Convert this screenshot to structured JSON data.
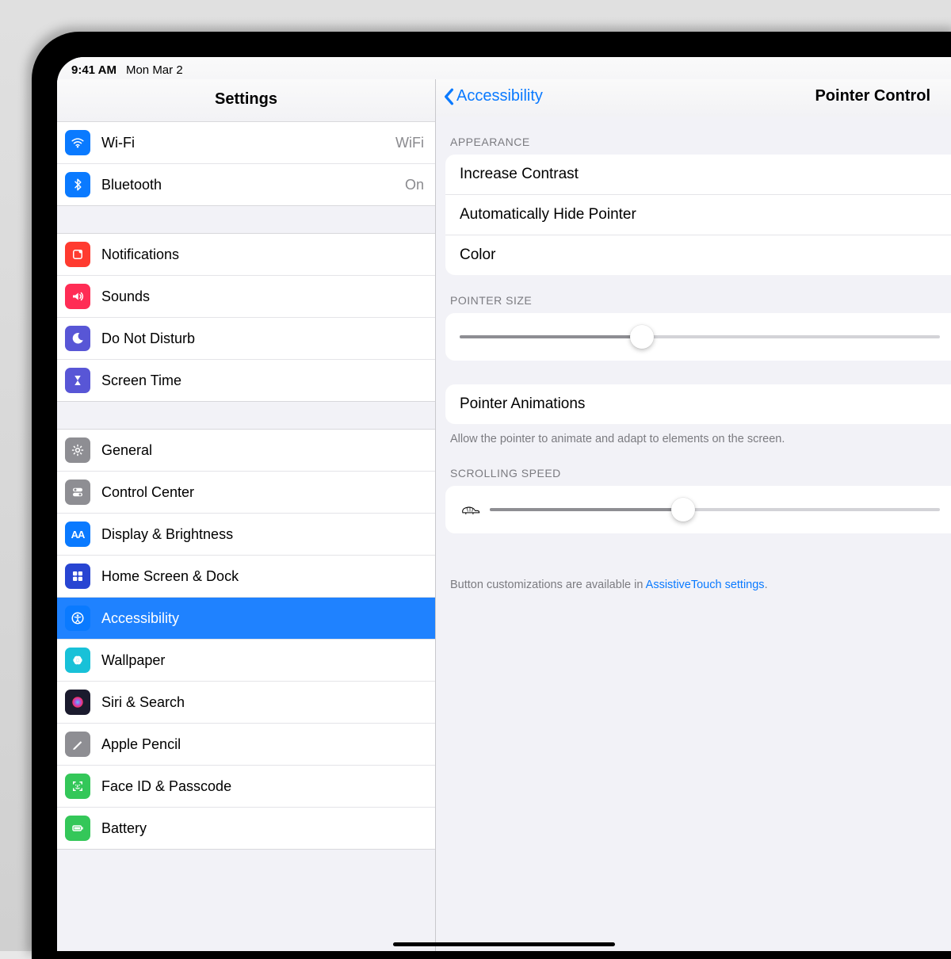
{
  "statusbar": {
    "time": "9:41 AM",
    "date": "Mon Mar 2"
  },
  "sidebar": {
    "title": "Settings",
    "groups": [
      [
        {
          "id": "wifi",
          "label": "Wi-Fi",
          "value": "WiFi",
          "icon": "wifi",
          "bg": "#0a7aff"
        },
        {
          "id": "bluetooth",
          "label": "Bluetooth",
          "value": "On",
          "icon": "bluetooth",
          "bg": "#0a7aff"
        }
      ],
      [
        {
          "id": "notifications",
          "label": "Notifications",
          "icon": "bell-badge",
          "bg": "#ff3b30"
        },
        {
          "id": "sounds",
          "label": "Sounds",
          "icon": "speaker",
          "bg": "#ff2d55"
        },
        {
          "id": "dnd",
          "label": "Do Not Disturb",
          "icon": "moon",
          "bg": "#5856d6"
        },
        {
          "id": "screentime",
          "label": "Screen Time",
          "icon": "hourglass",
          "bg": "#5856d6"
        }
      ],
      [
        {
          "id": "general",
          "label": "General",
          "icon": "gear",
          "bg": "#8e8e93"
        },
        {
          "id": "controlcenter",
          "label": "Control Center",
          "icon": "toggles",
          "bg": "#8e8e93"
        },
        {
          "id": "display",
          "label": "Display & Brightness",
          "icon": "aa",
          "bg": "#0a7aff"
        },
        {
          "id": "home",
          "label": "Home Screen & Dock",
          "icon": "grid",
          "bg": "#2845d2"
        },
        {
          "id": "accessibility",
          "label": "Accessibility",
          "icon": "accessibility",
          "bg": "#0a7aff",
          "selected": true
        },
        {
          "id": "wallpaper",
          "label": "Wallpaper",
          "icon": "flower",
          "bg": "#18c1d8"
        },
        {
          "id": "siri",
          "label": "Siri & Search",
          "icon": "siri",
          "bg": "#1b1b2e"
        },
        {
          "id": "pencil",
          "label": "Apple Pencil",
          "icon": "pencil",
          "bg": "#8e8e93"
        },
        {
          "id": "faceid",
          "label": "Face ID & Passcode",
          "icon": "faceid",
          "bg": "#34c759"
        },
        {
          "id": "battery",
          "label": "Battery",
          "icon": "battery",
          "bg": "#34c759"
        }
      ]
    ]
  },
  "detail": {
    "back_label": "Accessibility",
    "title": "Pointer Control",
    "sections": {
      "appearance_header": "APPEARANCE",
      "appearance_rows": {
        "increase_contrast": "Increase Contrast",
        "auto_hide": "Automatically Hide Pointer",
        "color": "Color"
      },
      "pointer_size_header": "POINTER SIZE",
      "pointer_size_value_pct": 38,
      "pointer_animations_label": "Pointer Animations",
      "pointer_animations_note": "Allow the pointer to animate and adapt to elements on the screen.",
      "scrolling_speed_header": "SCROLLING SPEED",
      "scrolling_speed_value_pct": 43,
      "footer_note_prefix": "Button customizations are available in ",
      "footer_note_link": "AssistiveTouch settings",
      "footer_note_suffix": "."
    }
  }
}
